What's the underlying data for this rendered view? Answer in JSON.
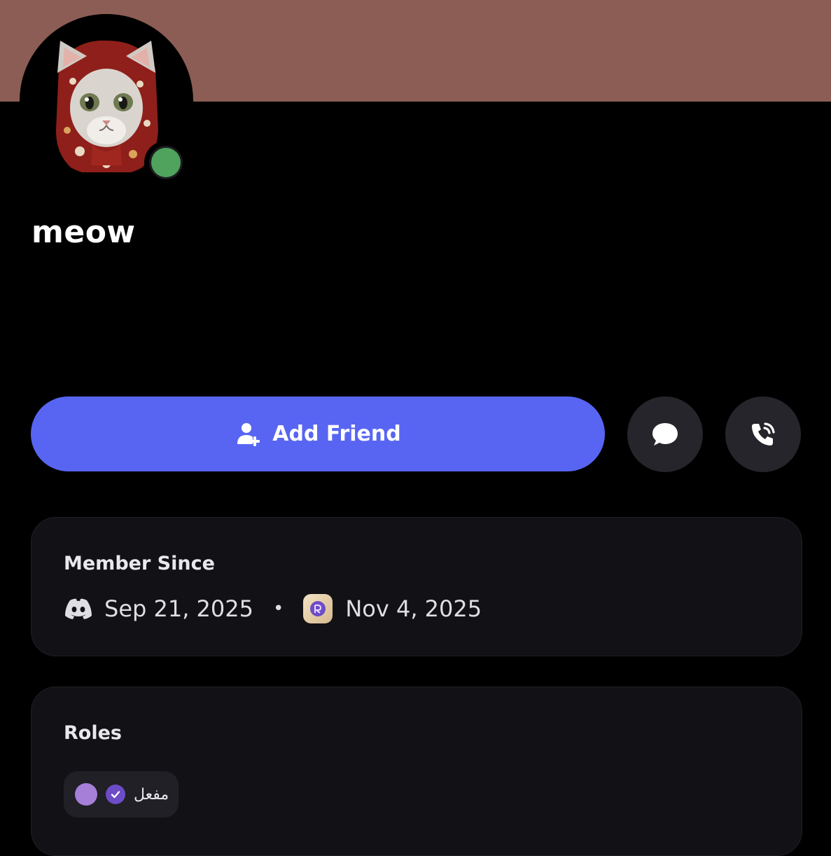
{
  "profile": {
    "username": "meow",
    "avatar_icon": "cat-headscarf-avatar",
    "status_icon": "online-status-icon",
    "banner_color": "#8c5d54",
    "status_color": "#4fa35d"
  },
  "actions": {
    "add_friend_label": "Add Friend",
    "add_friend_icon": "add-user-icon",
    "message_icon": "chat-bubble-icon",
    "call_icon": "phone-call-icon",
    "accent_color": "#5865f2"
  },
  "member_since": {
    "title": "Member Since",
    "discord_date": "Sep 21, 2025",
    "separator": "•",
    "server_date": "Nov 4, 2025"
  },
  "roles": {
    "title": "Roles",
    "items": [
      {
        "name": "مفعل",
        "color": "#a67fd9",
        "icon": "verified-check-icon"
      }
    ]
  }
}
